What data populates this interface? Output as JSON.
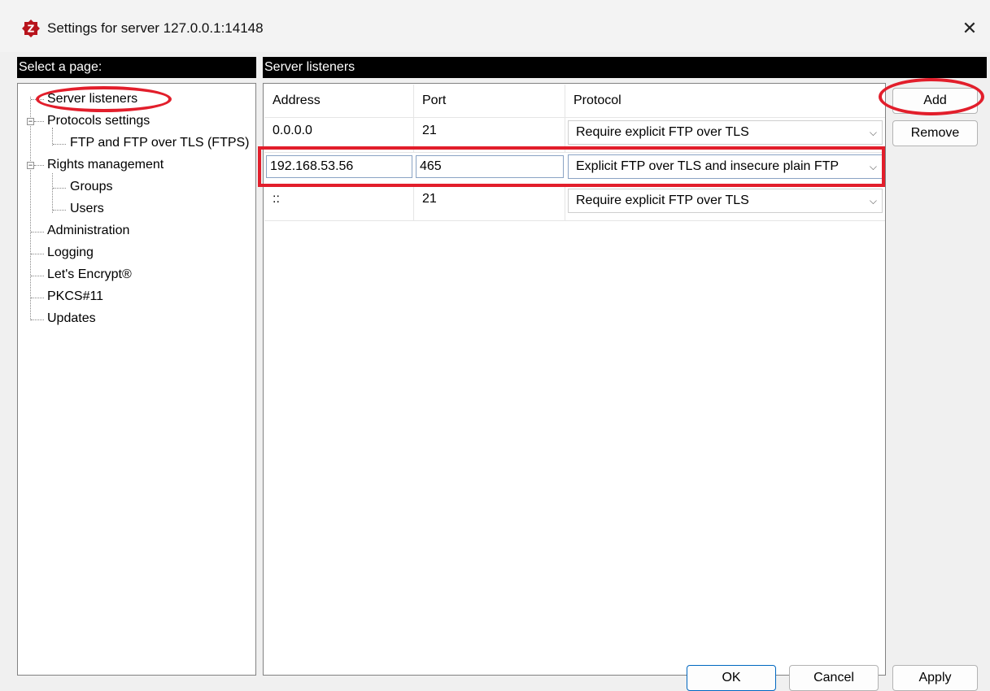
{
  "window": {
    "title": "Settings for server 127.0.0.1:14148",
    "close_glyph": "✕"
  },
  "left_pane": {
    "header": "Select a page:",
    "tree": [
      {
        "label": "Server listeners"
      },
      {
        "label": "Protocols settings",
        "expander": "−"
      },
      {
        "label": "FTP and FTP over TLS (FTPS)"
      },
      {
        "label": "Rights management",
        "expander": "−"
      },
      {
        "label": "Groups"
      },
      {
        "label": "Users"
      },
      {
        "label": "Administration"
      },
      {
        "label": "Logging"
      },
      {
        "label": "Let's Encrypt®"
      },
      {
        "label": "PKCS#11"
      },
      {
        "label": "Updates"
      }
    ]
  },
  "right_pane": {
    "header": "Server listeners",
    "columns": [
      "Address",
      "Port",
      "Protocol"
    ],
    "rows": [
      {
        "address": "0.0.0.0",
        "port": "21",
        "protocol": "Require explicit FTP over TLS"
      },
      {
        "address": "192.168.53.56",
        "port": "465",
        "protocol": "Explicit FTP over TLS and insecure plain FTP"
      },
      {
        "address": "::",
        "port": "21",
        "protocol": "Require explicit FTP over TLS"
      }
    ],
    "buttons": {
      "add": "Add",
      "remove": "Remove"
    }
  },
  "footer": {
    "ok": "OK",
    "cancel": "Cancel",
    "apply": "Apply"
  },
  "colors": {
    "annotation": "#e21e2b",
    "header_bg": "#000000",
    "accent": "#0067c0"
  },
  "icons": {
    "app": "filezilla-server-icon",
    "dropdown": "chevron-down-icon",
    "close": "close-icon"
  }
}
